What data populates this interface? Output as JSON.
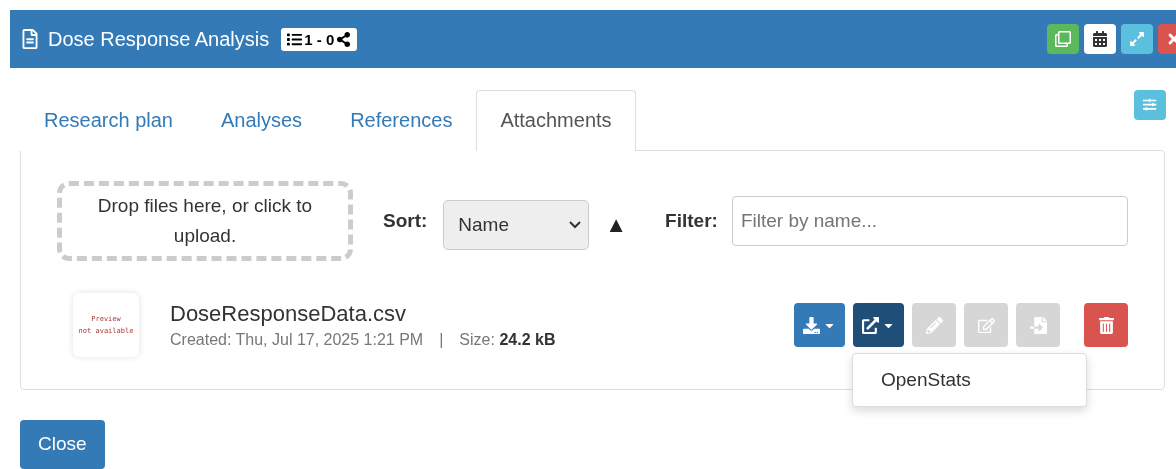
{
  "window": {
    "title": "Dose Response Analysis",
    "badge": {
      "count": "1 - 0"
    },
    "buttons": [
      {
        "kind": "duplicate",
        "color": "#5cb85c"
      },
      {
        "kind": "calendar",
        "color": "#ffffff"
      },
      {
        "kind": "expand",
        "color": "#5bc0de"
      },
      {
        "kind": "close",
        "color": "#d9534f"
      }
    ]
  },
  "tabs": [
    {
      "label": "Research plan",
      "selected": false
    },
    {
      "label": "Analyses",
      "selected": false
    },
    {
      "label": "References",
      "selected": false
    },
    {
      "label": "Attachments",
      "selected": true
    }
  ],
  "dropzone": {
    "text": "Drop files here, or click to upload."
  },
  "sort": {
    "label": "Sort:",
    "value": "Name",
    "direction": "▲"
  },
  "filter": {
    "label": "Filter:",
    "placeholder": "Filter by name..."
  },
  "attachments": [
    {
      "preview": [
        "Preview",
        "not available"
      ],
      "name": "DoseResponseData.csv",
      "created": "Created: Thu, Jul 17, 2025 1:21 PM",
      "separator": "|",
      "size_label": "Size:",
      "size": "24.2 kB",
      "actions": [
        {
          "kind": "download",
          "disabled": false,
          "dropdown": true
        },
        {
          "kind": "open",
          "disabled": false,
          "dropdown": true,
          "expanded": true
        },
        {
          "kind": "annotate",
          "disabled": true
        },
        {
          "kind": "edit",
          "disabled": true
        },
        {
          "kind": "import",
          "disabled": true
        },
        {
          "kind": "delete",
          "disabled": false
        }
      ],
      "menu": [
        "OpenStats"
      ]
    }
  ],
  "footer": {
    "close": "Close"
  }
}
